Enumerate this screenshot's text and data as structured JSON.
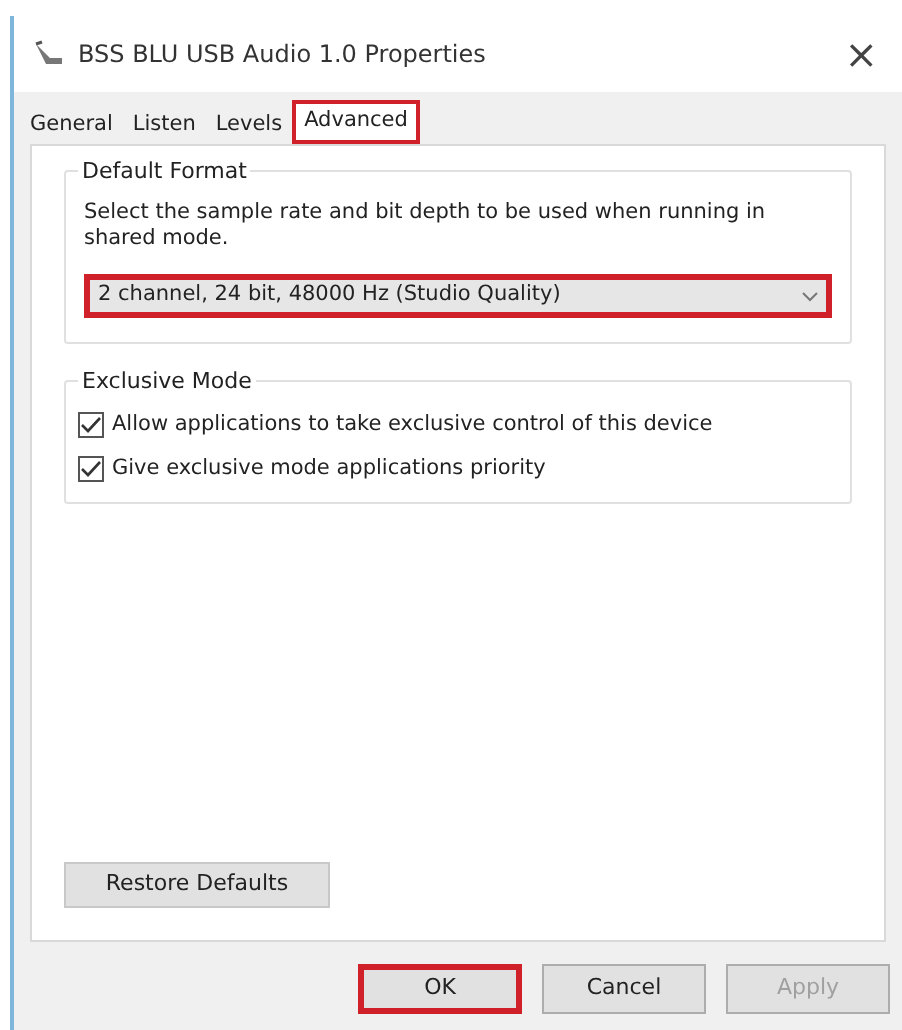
{
  "window": {
    "title": "BSS BLU USB Audio 1.0  Properties",
    "close": "×"
  },
  "tabs": [
    {
      "label": "General",
      "selected": false,
      "highlighted": false
    },
    {
      "label": "Listen",
      "selected": false,
      "highlighted": false
    },
    {
      "label": "Levels",
      "selected": false,
      "highlighted": false
    },
    {
      "label": "Advanced",
      "selected": true,
      "highlighted": true
    }
  ],
  "default_format": {
    "title": "Default Format",
    "description": "Select the sample rate and bit depth to be used when running in shared mode.",
    "dropdown": {
      "value": "2 channel, 24 bit, 48000 Hz (Studio Quality)",
      "highlighted": true
    }
  },
  "exclusive_mode": {
    "title": "Exclusive Mode",
    "options": [
      {
        "label": "Allow applications to take exclusive control of this device",
        "checked": true
      },
      {
        "label": "Give exclusive mode applications priority",
        "checked": true
      }
    ]
  },
  "restore_button": "Restore Defaults",
  "buttons": [
    {
      "label": "OK",
      "disabled": false,
      "highlighted": true
    },
    {
      "label": "Cancel",
      "disabled": false,
      "highlighted": false
    },
    {
      "label": "Apply",
      "disabled": true,
      "highlighted": false
    }
  ]
}
